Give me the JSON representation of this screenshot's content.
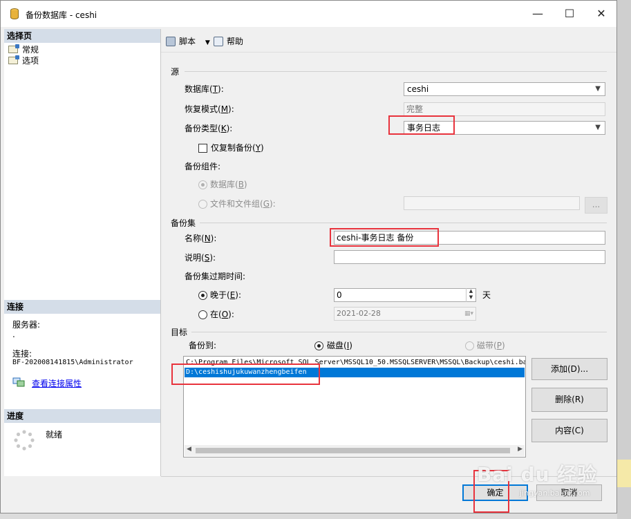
{
  "window": {
    "title": "备份数据库 - ceshi",
    "controls": {
      "minimize": "—",
      "maximize": "☐",
      "close": "✕"
    }
  },
  "left": {
    "select_page_header": "选择页",
    "pages": [
      {
        "label": "常规"
      },
      {
        "label": "选项"
      }
    ],
    "connection_header": "连接",
    "server_label": "服务器:",
    "server_value": ".",
    "connection_label": "连接:",
    "connection_value": "BF-202008141815\\Administrator",
    "view_connection_link": "查看连接属性",
    "progress_header": "进度",
    "progress_status": "就绪"
  },
  "toolbar": {
    "script": "脚本",
    "help": "帮助"
  },
  "source": {
    "group": "源",
    "database_label": "数据库(",
    "database_key": "T",
    "database_suffix": "):",
    "database_value": "ceshi",
    "recovery_label": "恢复模式(",
    "recovery_key": "M",
    "recovery_suffix": "):",
    "recovery_value": "完整",
    "backup_type_label": "备份类型(",
    "backup_type_key": "K",
    "backup_type_suffix": "):",
    "backup_type_value": "事务日志",
    "copy_only_label": "仅复制备份(",
    "copy_only_key": "Y",
    "copy_only_suffix": ")",
    "component_label": "备份组件:",
    "component_db_label": "数据库(",
    "component_db_key": "B",
    "component_db_suffix": ")",
    "component_files_label": "文件和文件组(",
    "component_files_key": "G",
    "component_files_suffix": "):",
    "browse_button": "..."
  },
  "backup_set": {
    "group": "备份集",
    "name_label": "名称(",
    "name_key": "N",
    "name_suffix": "):",
    "name_value": "ceshi-事务日志  备份",
    "desc_label": "说明(",
    "desc_key": "S",
    "desc_suffix": "):",
    "desc_value": "",
    "expire_label": "备份集过期时间:",
    "after_label": "晚于(",
    "after_key": "E",
    "after_suffix": "):",
    "after_value": "0",
    "after_unit": "天",
    "on_label": "在(",
    "on_key": "O",
    "on_suffix": "):",
    "on_value": "2021-02-28"
  },
  "destination": {
    "group": "目标",
    "backup_to_label": "备份到:",
    "disk_label": "磁盘(",
    "disk_key": "I",
    "disk_suffix": ")",
    "tape_label": "磁带(",
    "tape_key": "P",
    "tape_suffix": ")",
    "list": [
      {
        "path": "C:\\Program Files\\Microsoft SQL Server\\MSSQL10_50.MSSQLSERVER\\MSSQL\\Backup\\ceshi.ba",
        "selected": false
      },
      {
        "path": "D:\\ceshishujukuwanzhengbeifen",
        "selected": true
      }
    ],
    "add_button": "添加(D)...",
    "remove_button": "删除(R)",
    "contents_button": "内容(C)"
  },
  "footer": {
    "ok": "确定",
    "cancel": "取消"
  },
  "watermark": {
    "main": "Bai du 经验",
    "sub": "jingyan.baidu.com"
  },
  "colors": {
    "highlight": "#e8323c",
    "selection": "#0078d7",
    "section_header": "#d4dde8",
    "link": "#0000ee"
  }
}
